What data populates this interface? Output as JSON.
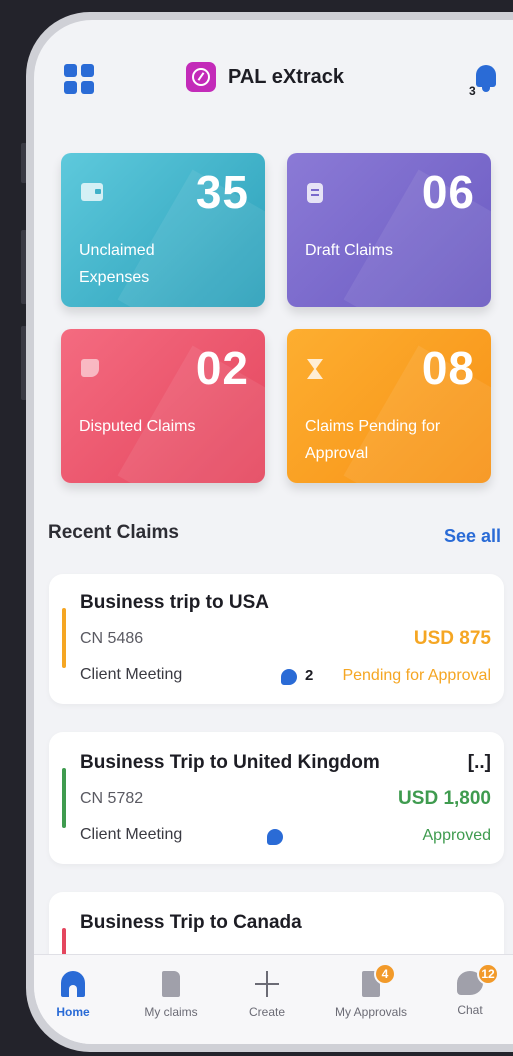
{
  "app": {
    "title": "PAL eXtrack",
    "notifications": "3"
  },
  "stats": [
    {
      "value": "35",
      "label": "Unclaimed Expenses"
    },
    {
      "value": "06",
      "label": "Draft Claims"
    },
    {
      "value": "02",
      "label": "Disputed Claims"
    },
    {
      "value": "08",
      "label": "Claims Pending for Approval"
    }
  ],
  "recent": {
    "heading": "Recent Claims",
    "see_all": "See all",
    "claims": [
      {
        "title": "Business trip to USA",
        "more": "",
        "cn": "CN 5486",
        "amount": "USD 875",
        "type": "Client Meeting",
        "comments": "2",
        "status": "Pending for Approval",
        "accent": "#f5a623"
      },
      {
        "title": "Business Trip to United Kingdom",
        "more": "[..]",
        "cn": "CN 5782",
        "amount": "USD 1,800",
        "type": "Client Meeting",
        "comments": "",
        "status": "Approved",
        "accent": "#3f9b4f"
      },
      {
        "title": "Business Trip to Canada",
        "more": "",
        "cn": "",
        "amount": "",
        "type": "",
        "comments": "",
        "status": "",
        "accent": "#e4465e"
      }
    ]
  },
  "tabs": [
    {
      "label": "Home",
      "badge": ""
    },
    {
      "label": "My claims",
      "badge": ""
    },
    {
      "label": "Create",
      "badge": ""
    },
    {
      "label": "My Approvals",
      "badge": "4"
    },
    {
      "label": "Chat",
      "badge": "12"
    }
  ],
  "colors": {
    "primary": "#2a6bd6",
    "pending": "#f5a623",
    "approved": "#3f9b4f"
  }
}
